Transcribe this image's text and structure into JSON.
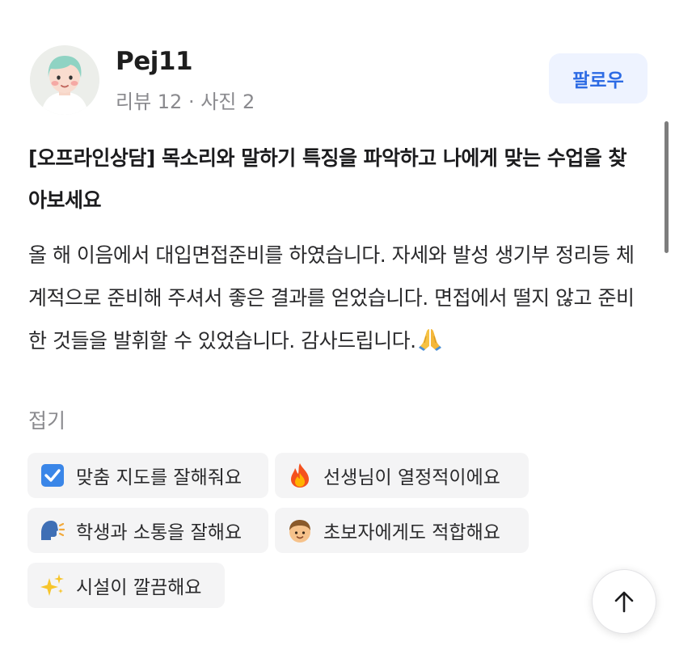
{
  "profile": {
    "username": "Pej11",
    "stats": "리뷰 12 · 사진 2",
    "follow_label": "팔로우"
  },
  "review": {
    "title": "[오프라인상담] 목소리와 말하기 특징을 파악하고 나에게 맞는 수업을 찾아보세요",
    "body": "올 해 이음에서 대입면접준비를 하였습니다. 자세와 발성 생기부 정리등 체계적으로 준비해 주셔서 좋은 결과를 얻었습니다. 면접에서 떨지 않고 준비한 것들을 발휘할 수 있었습니다. 감사드립니다.",
    "body_emoji_icon": "folded-hands-icon",
    "fold_label": "접기"
  },
  "tags": [
    {
      "icon": "checkbox-icon",
      "label": "맞춤 지도를 잘해줘요"
    },
    {
      "icon": "fire-icon",
      "label": "선생님이 열정적이에요"
    },
    {
      "icon": "speaking-head-icon",
      "label": "학생과 소통을 잘해요"
    },
    {
      "icon": "boy-face-icon",
      "label": "초보자에게도 적합해요"
    },
    {
      "icon": "sparkles-icon",
      "label": "시설이 깔끔해요"
    }
  ],
  "colors": {
    "accent": "#2d6be4",
    "follow_bg": "#eef3ff",
    "tag_bg": "#f4f4f5",
    "muted_text": "#8a8a8e"
  },
  "scroll_top_icon": "arrow-up-icon"
}
